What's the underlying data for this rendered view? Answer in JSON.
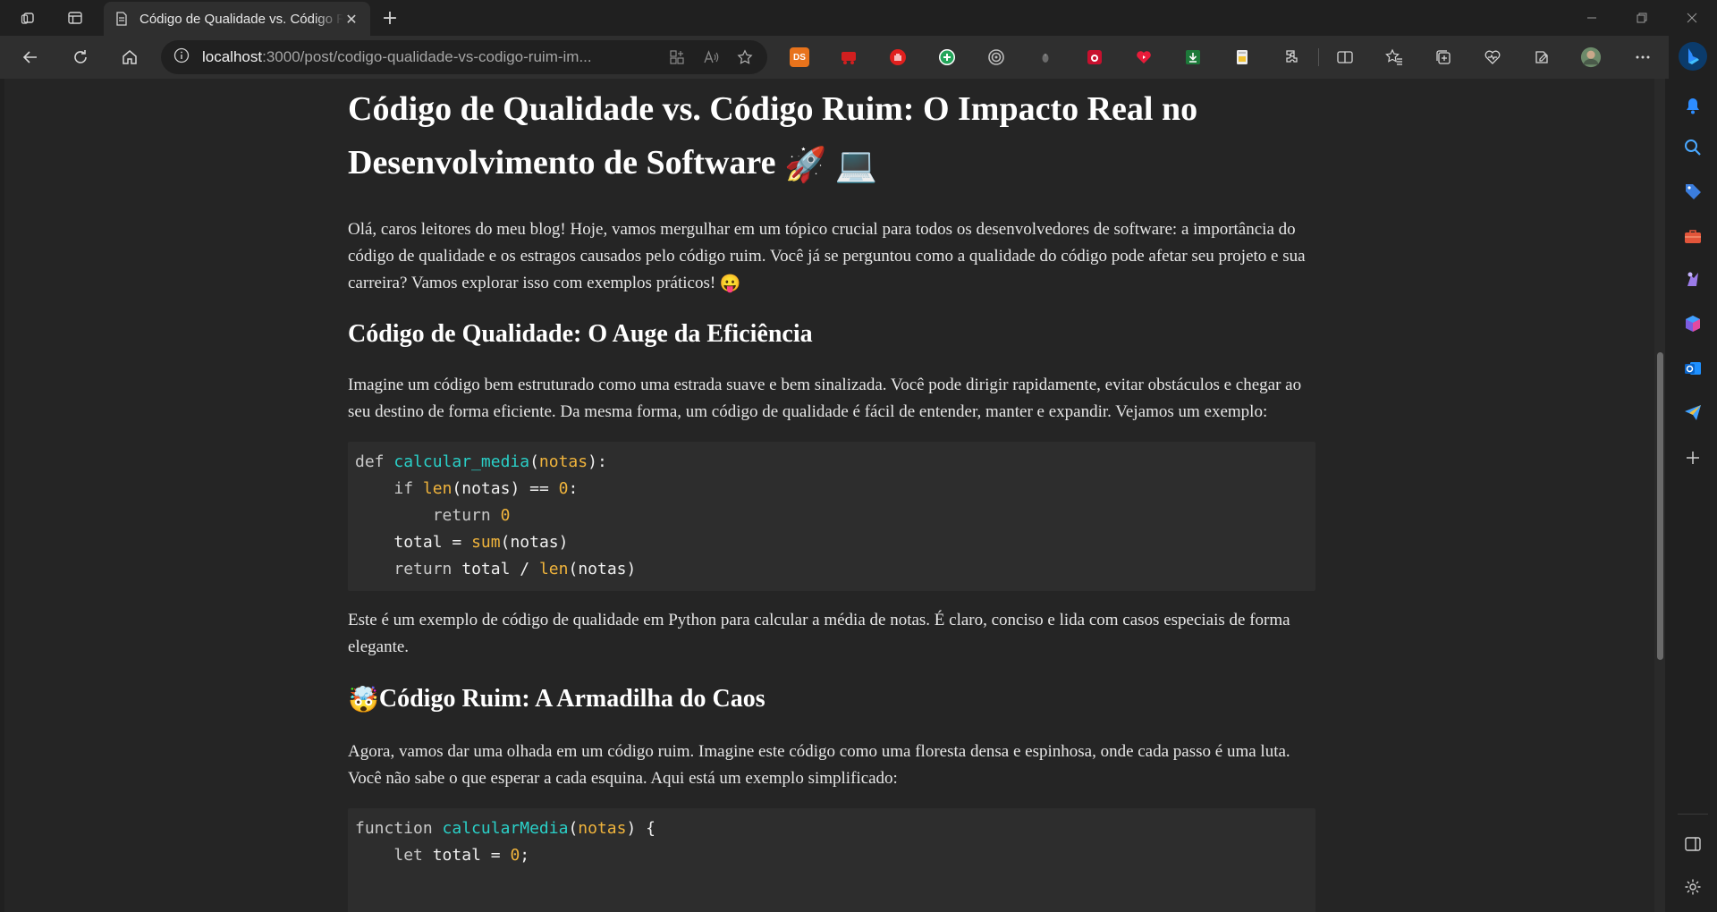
{
  "browser": {
    "tab_title": "Código de Qualidade vs. Código Ruim",
    "new_tab_label": "+",
    "url_host": "localhost",
    "url_rest": ":3000/post/codigo-qualidade-vs-codigo-ruim-im...",
    "extensions": {
      "ds_label": "DS"
    }
  },
  "article": {
    "title": "Código de Qualidade vs. Código Ruim: O Impacto Real no Desenvolvimento de Software",
    "title_emoji_1": "🚀",
    "title_emoji_2": "💻",
    "intro": "Olá, caros leitores do meu blog! Hoje, vamos mergulhar em um tópico crucial para todos os desenvolvedores de software: a importância do código de qualidade e os estragos causados pelo código ruim. Você já se perguntou como a qualidade do código pode afetar seu projeto e sua carreira? Vamos explorar isso com exemplos práticos!",
    "intro_emoji": "😛",
    "section1_heading": "Código de Qualidade: O Auge da Eficiência",
    "section1_text": "Imagine um código bem estruturado como uma estrada suave e bem sinalizada. Você pode dirigir rapidamente, evitar obstáculos e chegar ao seu destino de forma eficiente. Da mesma forma, um código de qualidade é fácil de entender, manter e expandir. Vejamos um exemplo:",
    "code1": {
      "kw_def": "def",
      "fn_name": "calcular_media",
      "param": "notas",
      "kw_if": "if",
      "len": "len",
      "var_notas": "notas",
      "op_eq": "==",
      "zero": "0",
      "kw_return": "return",
      "var_total": "total",
      "op_assign": "=",
      "sum": "sum",
      "op_div": "/"
    },
    "section1_after": "Este é um exemplo de código de qualidade em Python para calcular a média de notas. É claro, conciso e lida com casos especiais de forma elegante.",
    "section2_emoji": "🤯",
    "section2_heading": "Código Ruim: A Armadilha do Caos",
    "section2_text": "Agora, vamos dar uma olhada em um código ruim. Imagine este código como uma floresta densa e espinhosa, onde cada passo é uma luta. Você não sabe o que esperar a cada esquina. Aqui está um exemplo simplificado:",
    "code2": {
      "kw_function": "function",
      "fn_name": "calcularMedia",
      "param": "notas",
      "brace": "{",
      "kw_let": "let",
      "var_total": "total",
      "op_assign": "=",
      "zero": "0",
      "semi": ";"
    }
  }
}
